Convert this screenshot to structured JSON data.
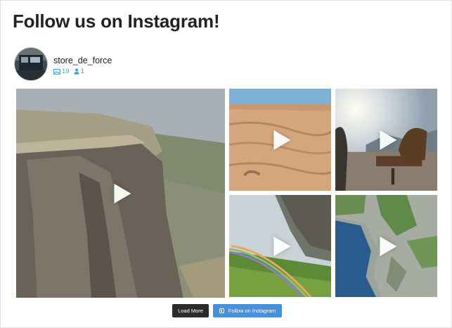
{
  "feed": {
    "heading": "Follow us on Instagram!",
    "profile": {
      "username": "store_de_force",
      "posts_count": "19",
      "followers_count": "1"
    },
    "posts": [
      {
        "subject": "cliff-canyon",
        "type": "video"
      },
      {
        "subject": "sand-dunes",
        "type": "video"
      },
      {
        "subject": "terrace-sunset",
        "type": "video"
      },
      {
        "subject": "waterfall-rainbow",
        "type": "video"
      },
      {
        "subject": "aerial-coast",
        "type": "video"
      }
    ],
    "buttons": {
      "load_more": "Load More",
      "follow": "Follow on Instagram"
    },
    "colors": {
      "stats": "#3aa7c9",
      "load_more_bg": "#2b2b2b",
      "follow_bg": "#4a90d9"
    }
  }
}
